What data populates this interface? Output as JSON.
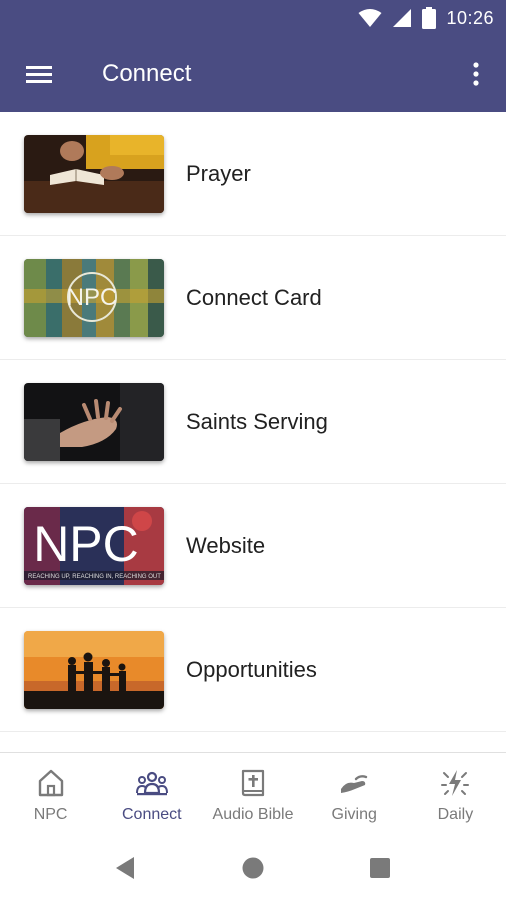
{
  "status_bar": {
    "time": "10:26",
    "icons": [
      "wifi-icon",
      "signal-icon",
      "battery-icon"
    ]
  },
  "app_bar": {
    "title": "Connect",
    "left_icon": "menu-icon",
    "right_icon": "more-vert-icon",
    "color": "#4a4c82"
  },
  "list": {
    "items": [
      {
        "label": "Prayer",
        "image": "prayer-thumbnail"
      },
      {
        "label": "Connect Card",
        "image": "connect-card-thumbnail"
      },
      {
        "label": "Saints Serving",
        "image": "saints-serving-thumbnail"
      },
      {
        "label": "Website",
        "image": "website-thumbnail"
      },
      {
        "label": "Opportunities",
        "image": "opportunities-thumbnail"
      }
    ]
  },
  "bottom_nav": {
    "active_color": "#4a4c82",
    "inactive_color": "#7a7a7a",
    "items": [
      {
        "label": "NPC",
        "icon": "home-icon",
        "active": false
      },
      {
        "label": "Connect",
        "icon": "people-icon",
        "active": true
      },
      {
        "label": "Audio Bible",
        "icon": "bible-icon",
        "active": false
      },
      {
        "label": "Giving",
        "icon": "giving-hand-icon",
        "active": false
      },
      {
        "label": "Daily",
        "icon": "daily-spark-icon",
        "active": false
      }
    ]
  },
  "system_nav": {
    "icons": [
      "back-icon",
      "home-circle-icon",
      "recents-icon"
    ]
  }
}
